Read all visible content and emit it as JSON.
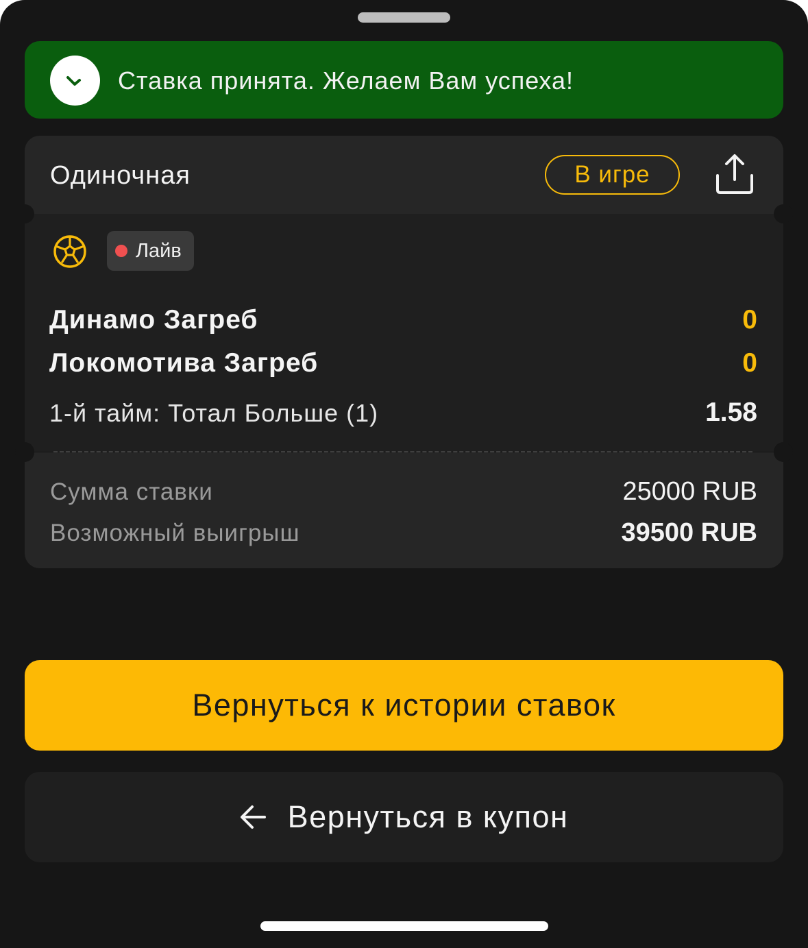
{
  "toast": {
    "message": "Ставка принята. Желаем Вам успеха!",
    "icon": "check-icon",
    "color": "#0a5e0e"
  },
  "bet_card": {
    "type_label": "Одиночная",
    "status_label": "В игре",
    "share_icon": "share-icon",
    "sport_icon": "football-icon",
    "live_label": "Лайв",
    "teams": [
      {
        "name": "Динамо Загреб",
        "score": "0"
      },
      {
        "name": "Локомотива Загреб",
        "score": "0"
      }
    ],
    "market": "1-й тайм: Тотал Больше (1)",
    "odds": "1.58",
    "stake_label": "Сумма ставки",
    "stake_value": "25000 RUB",
    "payout_label": "Возможный выигрыш",
    "payout_value": "39500 RUB"
  },
  "actions": {
    "history_label": "Вернуться к истории ставок",
    "coupon_label": "Вернуться в купон",
    "coupon_icon": "arrow-left-icon"
  },
  "colors": {
    "accent": "#fdb905",
    "live_dot": "#f05050",
    "background": "#161616"
  }
}
